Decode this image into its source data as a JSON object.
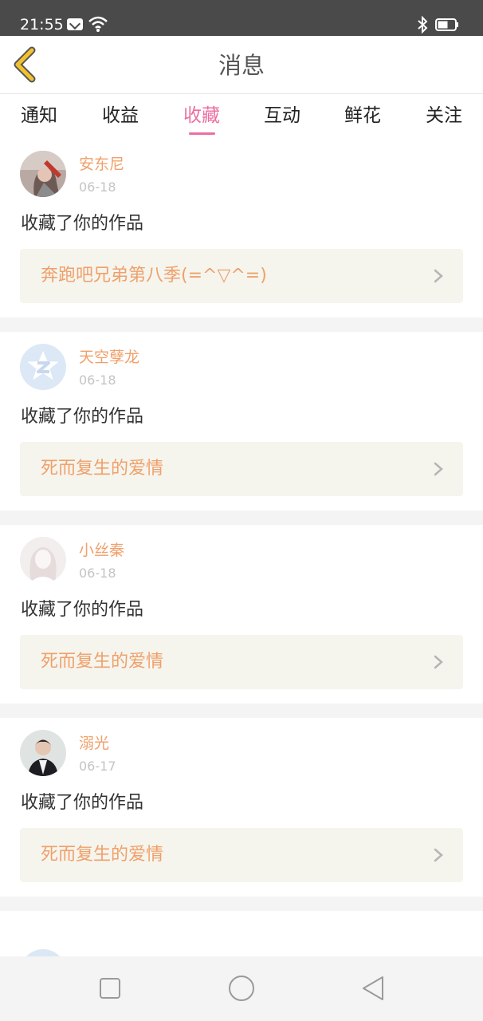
{
  "status_bar": {
    "time": "21:55",
    "icons": [
      "mail-icon",
      "wifi-icon",
      "bluetooth-icon",
      "battery-icon"
    ]
  },
  "header": {
    "title": "消息",
    "back_icon": "back-chevron-icon"
  },
  "tabs": [
    {
      "label": "通知"
    },
    {
      "label": "收益"
    },
    {
      "label": "收藏",
      "active": true
    },
    {
      "label": "互动"
    },
    {
      "label": "鲜花"
    },
    {
      "label": "关注"
    }
  ],
  "colors": {
    "accent": "#ec6fa1",
    "name": "#f0a06a",
    "work_bg": "#f5f5ee",
    "back": "#f2c12e"
  },
  "messages": [
    {
      "user": "安东尼",
      "date": "06-18",
      "text": "收藏了你的作品",
      "work": "奔跑吧兄弟第八季(=^▽^=)",
      "avatar": "photo-avatar-1"
    },
    {
      "user": "天空孽龙",
      "date": "06-18",
      "text": "收藏了你的作品",
      "work": "死而复生的爱情",
      "avatar": "qzone-avatar"
    },
    {
      "user": "小丝秦",
      "date": "06-18",
      "text": "收藏了你的作品",
      "work": "死而复生的爱情",
      "avatar": "default-avatar"
    },
    {
      "user": "溺光",
      "date": "06-17",
      "text": "收藏了你的作品",
      "work": "死而复生的爱情",
      "avatar": "photo-avatar-2"
    }
  ],
  "nav": {
    "icons": [
      "square-recent-icon",
      "circle-home-icon",
      "triangle-back-icon"
    ]
  }
}
